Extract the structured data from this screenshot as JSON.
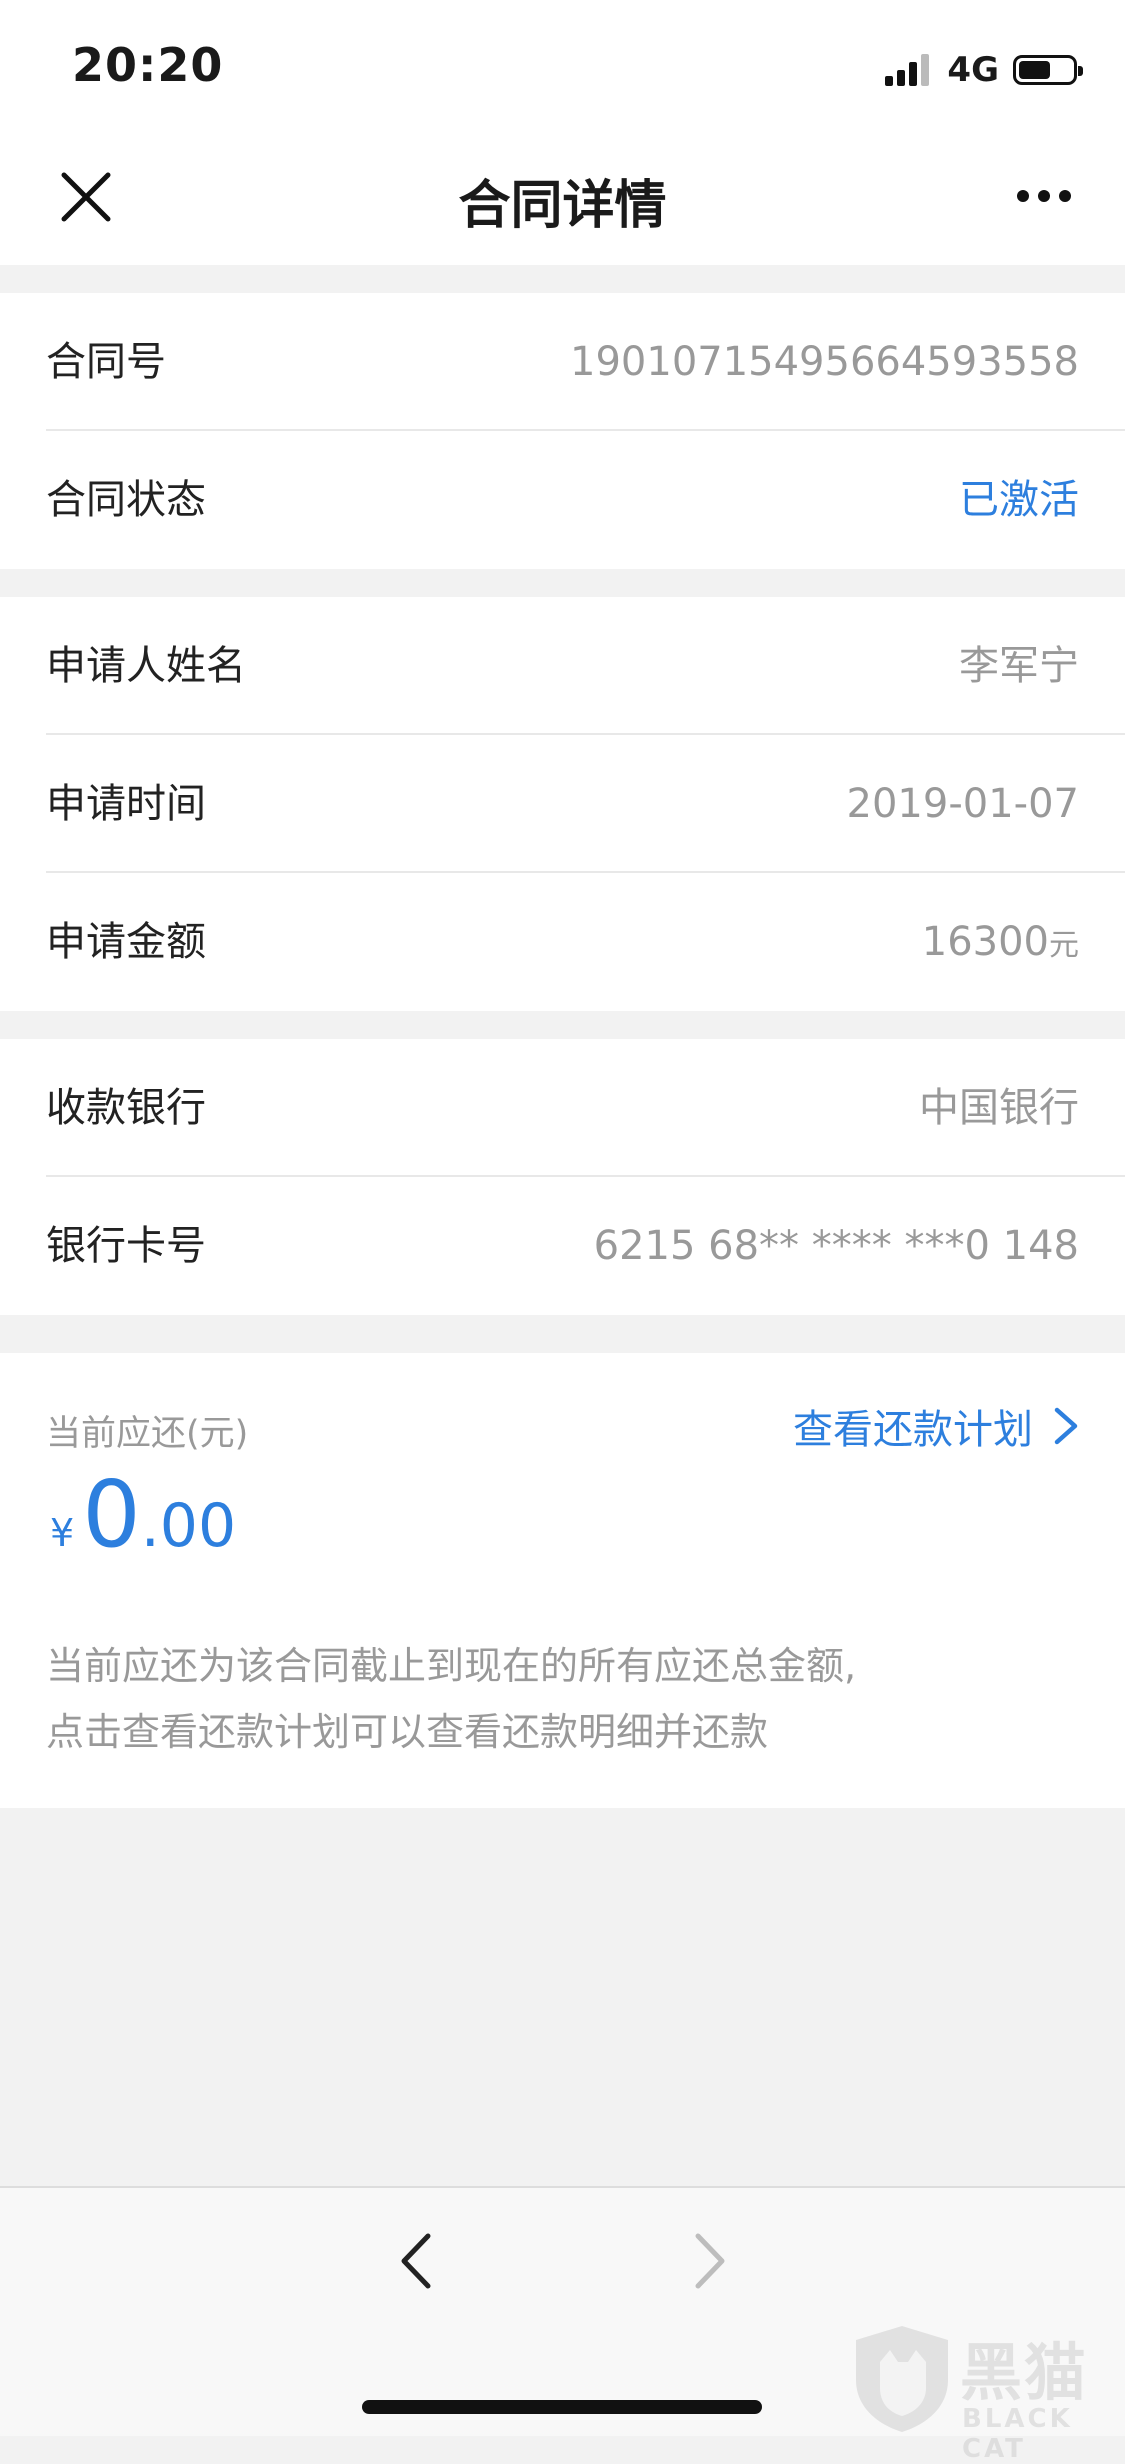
{
  "status_bar": {
    "time": "20:20",
    "network": "4G",
    "battery_level": 0.6
  },
  "nav": {
    "title": "合同详情",
    "close_icon": "close-icon",
    "more_icon": "more-dots-icon"
  },
  "sections": [
    {
      "rows": [
        {
          "label": "合同号",
          "value": "19010715495664593558"
        },
        {
          "label": "合同状态",
          "value": "已激活"
        }
      ]
    },
    {
      "rows": [
        {
          "label": "申请人姓名",
          "value": "李军宁"
        },
        {
          "label": "申请时间",
          "value": "2019-01-07"
        },
        {
          "label": "申请金额",
          "value": "16300",
          "unit": "元"
        }
      ]
    },
    {
      "rows": [
        {
          "label": "收款银行",
          "value": "中国银行"
        },
        {
          "label": "银行卡号",
          "value": "6215 68** **** ***0 148"
        }
      ]
    }
  ],
  "repayment": {
    "label": "当前应还(元)",
    "link": "查看还款计划",
    "currency": "¥",
    "amount_int": "0",
    "amount_dec": ".00",
    "note_line1": "当前应还为该合同截止到现在的所有应还总金额,",
    "note_line2": "点击查看还款计划可以查看还款明细并还款"
  },
  "watermark": {
    "cn": "黑猫",
    "en": "BLACK CAT"
  },
  "colors": {
    "accent": "#2d7fde",
    "muted": "#999999",
    "background": "#f2f2f2"
  }
}
